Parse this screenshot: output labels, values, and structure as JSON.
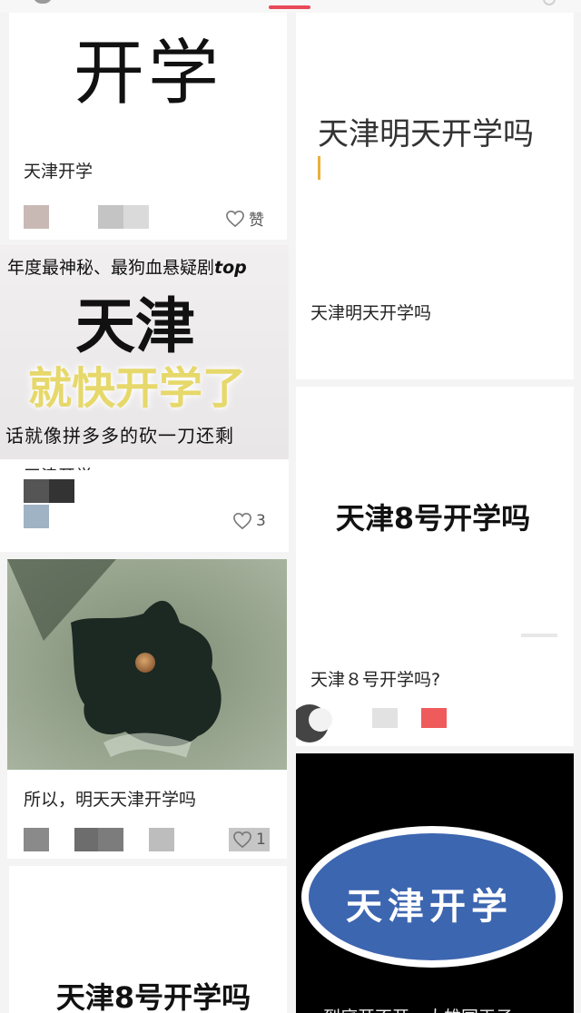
{
  "feed": {
    "tab_indicator_color": "#e84a5a",
    "cards": [
      {
        "cover_big_text": "开学",
        "caption": "天津开学",
        "like_label": "赞"
      },
      {
        "cover_big_text": "天津明天开学吗",
        "caption": "天津明天开学吗"
      },
      {
        "promo_top_text": "年度最神秘、最狗血悬疑剧",
        "promo_top_tag": "top",
        "promo_title": "天津",
        "promo_subtitle": "就快开学了",
        "promo_bottom_text": "话就像拼多多的砍一刀还剩",
        "caption_partial": "天津开学",
        "like_count": "3"
      },
      {
        "cover_big_text": "天津8号开学吗",
        "caption": "天津８号开学吗?"
      },
      {
        "caption": "所以，明天天津开学吗",
        "like_count": "1"
      },
      {
        "oval_text": "天津开学",
        "caption_partial": "到底开不开，大雄国王子"
      },
      {
        "cover_big_text": "天津8号开学吗"
      }
    ]
  },
  "icons": {
    "heart": "heart-outline-icon"
  }
}
